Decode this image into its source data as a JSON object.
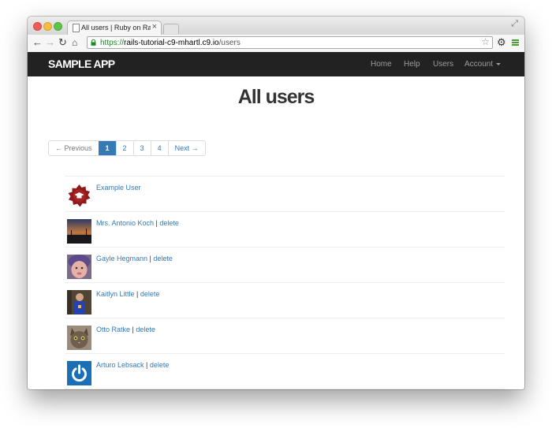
{
  "browser": {
    "tab_title": "All users | Ruby on Rails T",
    "url_scheme": "https://",
    "url_host": "rails-tutorial-c9-mhartl.c9.io",
    "url_path": "/users"
  },
  "navbar": {
    "brand": "SAMPLE APP",
    "links": [
      "Home",
      "Help",
      "Users",
      "Account"
    ]
  },
  "page": {
    "title": "All users"
  },
  "pagination": {
    "previous": "← Previous",
    "pages": [
      "1",
      "2",
      "3",
      "4"
    ],
    "active_page": "1",
    "next": "Next →"
  },
  "users": [
    {
      "name": "Example User",
      "delete": "",
      "avatar": "gravatar-logo-icon"
    },
    {
      "name": "Mrs. Antonio Koch",
      "delete": "delete",
      "avatar": "sunset-photo-icon"
    },
    {
      "name": "Gayle Hegmann",
      "delete": "delete",
      "avatar": "child-photo-icon"
    },
    {
      "name": "Kaitlyn Little",
      "delete": "delete",
      "avatar": "person-photo-icon"
    },
    {
      "name": "Otto Ratke",
      "delete": "delete",
      "avatar": "cat-photo-icon"
    },
    {
      "name": "Arturo Lebsack",
      "delete": "delete",
      "avatar": "power-icon"
    }
  ],
  "colors": {
    "navbar": "#222222",
    "link": "#337ab7",
    "active_page": "#337ab7"
  }
}
